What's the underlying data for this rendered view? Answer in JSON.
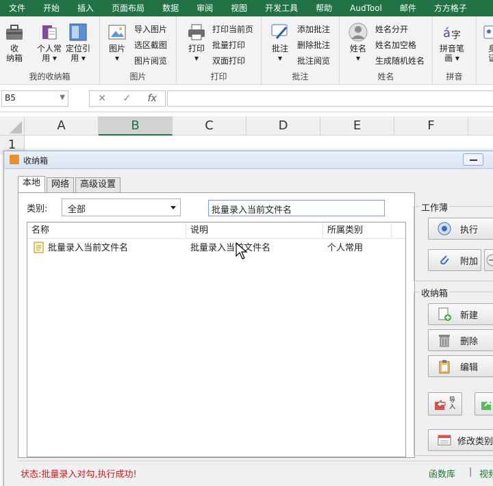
{
  "menu_tabs": [
    "文件",
    "开始",
    "插入",
    "页面布局",
    "数据",
    "审阅",
    "视图",
    "开发工具",
    "帮助",
    "AudTool",
    "邮件",
    "方方格子"
  ],
  "ribbon": {
    "groups": {
      "storage": {
        "label": "我的收纳箱",
        "buttons": [
          "收\n纳箱",
          "个人常\n用 ▾",
          "定位引\n用 ▾"
        ]
      },
      "picture": {
        "label": "图片",
        "big": "图片\n▾",
        "small": [
          "导入图片",
          "选区截图",
          "图片阅览"
        ]
      },
      "print": {
        "label": "打印",
        "big": "打印\n▾",
        "small": [
          "打印当前页",
          "批量打印",
          "双面打印"
        ]
      },
      "comment": {
        "label": "批注",
        "big": "批注\n▾",
        "small": [
          "添加批注",
          "删除批注",
          "批注阅览"
        ]
      },
      "name": {
        "label": "姓名",
        "big": "姓名\n▾",
        "small": [
          "姓名分开",
          "姓名加空格",
          "生成随机姓名"
        ]
      },
      "pinyin": {
        "label": "拼音",
        "big": "拼音笔\n画 ▾"
      },
      "extra": {
        "big": "身\n证"
      }
    }
  },
  "formula_bar": {
    "name_box": "B5",
    "cancel": "✕",
    "confirm": "✓",
    "fx": "fx",
    "value": ""
  },
  "columns": [
    "A",
    "B",
    "C",
    "D",
    "E",
    "F"
  ],
  "selected_column": "B",
  "first_row": "1",
  "dialog": {
    "title": "收纳箱",
    "tabs": [
      "本地",
      "网络",
      "高级设置"
    ],
    "active_tab": "本地",
    "category_label": "类别:",
    "category_value": "全部",
    "search_value": "批量录入当前文件名",
    "list_headers": [
      "名称",
      "说明",
      "所属类别"
    ],
    "rows": [
      {
        "name": "批量录入当前文件名",
        "desc": "批量录入当前文件名",
        "category": "个人常用"
      }
    ],
    "workbook_panel": {
      "label": "工作薄",
      "execute": "执行",
      "attach": "附加"
    },
    "storage_panel": {
      "label": "收纳箱",
      "new": "新建",
      "delete": "删除",
      "edit": "编辑",
      "import_icon_text": "导\n入",
      "modify_category": "修改类别"
    },
    "status_text": "状态:批量录入对勾,执行成功!",
    "link_library": "函数库",
    "link_separator": "|",
    "link_video": "视频"
  },
  "colors": {
    "ribbon_green": "#217346",
    "status_red": "#cc1a1a",
    "link_green": "#1b7a2e"
  }
}
